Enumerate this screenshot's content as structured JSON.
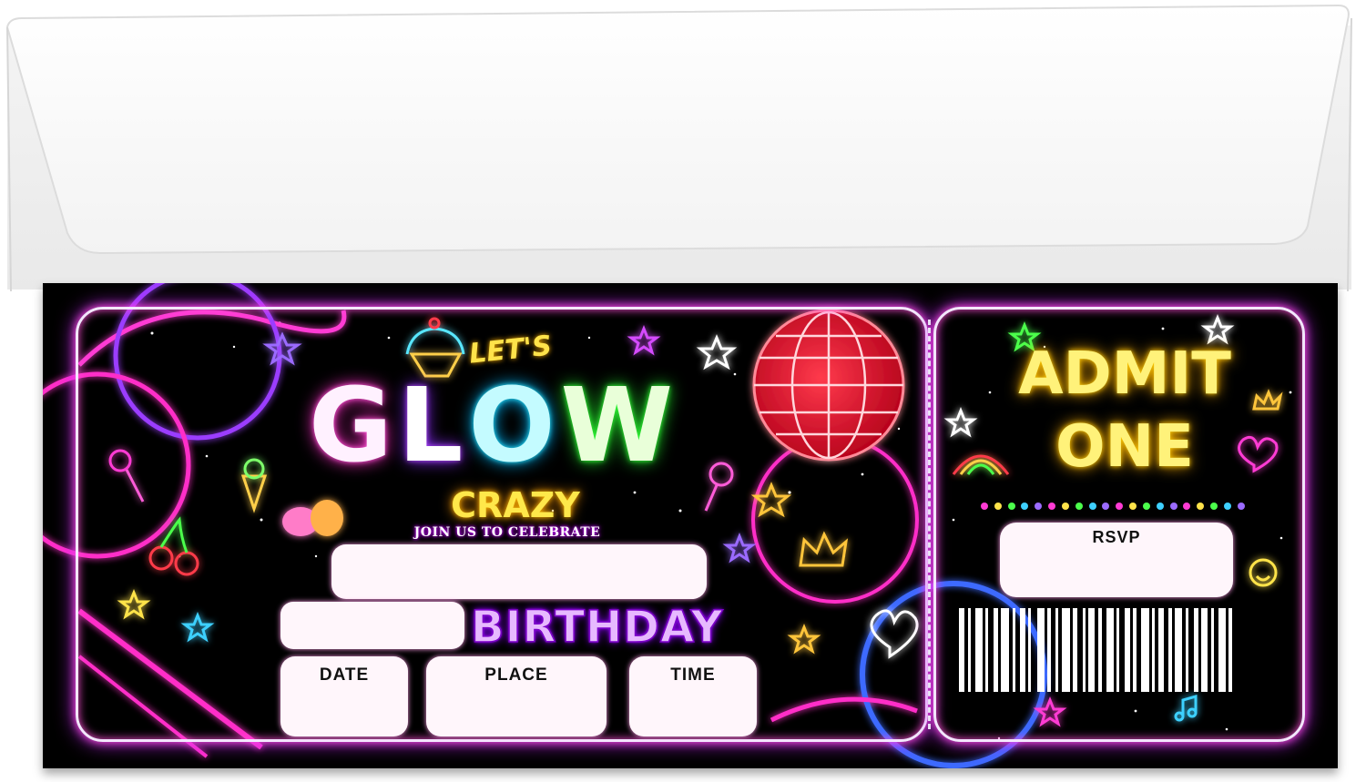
{
  "invitation": {
    "lets": "LET'S",
    "glow_letters": [
      "G",
      "L",
      "O",
      "W"
    ],
    "crazy": "CRAZY",
    "join": "JOIN US TO CELEBRATE",
    "birthday": "BIRTHDAY",
    "fields": {
      "date": "DATE",
      "place": "PLACE",
      "time": "TIME"
    }
  },
  "stub": {
    "admit_line1": "ADMIT",
    "admit_line2": "ONE",
    "rsvp": "RSVP"
  },
  "colors": {
    "pink": "#ff2fc8",
    "purple": "#8b2cff",
    "cyan": "#00b9ff",
    "green": "#21e52a",
    "yellow": "#ffe84a",
    "red": "#ff1f3d"
  }
}
